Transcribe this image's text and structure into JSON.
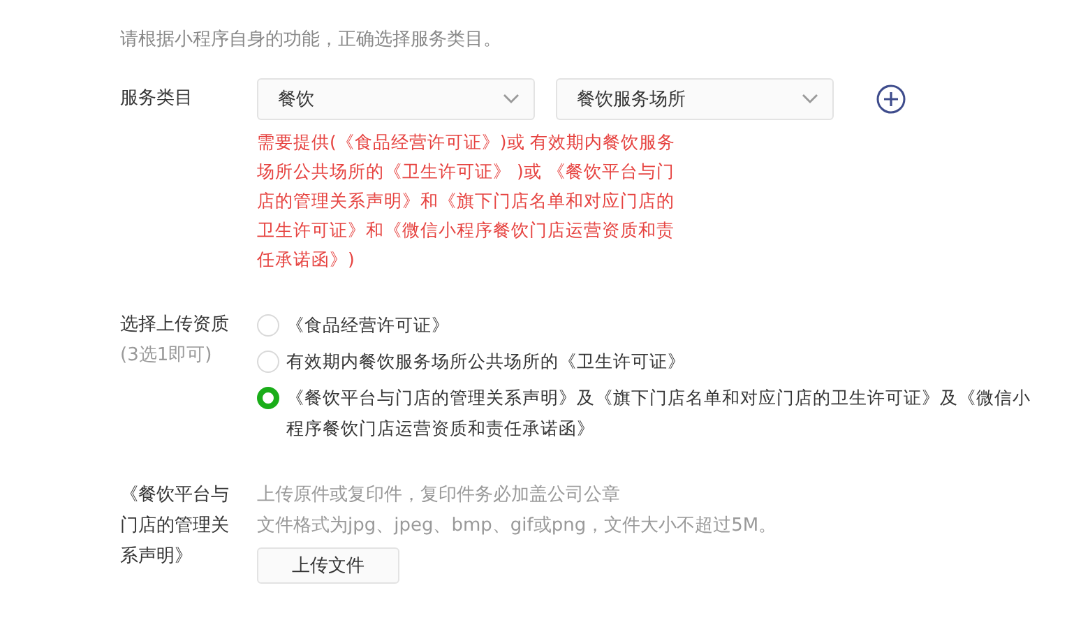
{
  "intro": "请根据小程序自身的功能，正确选择服务类目。",
  "category": {
    "label": "服务类目",
    "selects": [
      {
        "value": "餐饮"
      },
      {
        "value": "餐饮服务场所"
      }
    ],
    "requirement": "需要提供(《食品经营许可证》)或 有效期内餐饮服务场所公共场所的《卫生许可证》 )或 《餐饮平台与门店的管理关系声明》和《旗下门店名单和对应门店的卫生许可证》和《微信小程序餐饮门店运营资质和责任承诺函》)"
  },
  "qualification": {
    "label": "选择上传资质",
    "hint": "(3选1即可)",
    "options": [
      {
        "label": "《食品经营许可证》",
        "selected": false
      },
      {
        "label": "有效期内餐饮服务场所公共场所的《卫生许可证》",
        "selected": false
      },
      {
        "label": "《餐饮平台与门店的管理关系声明》及《旗下门店名单和对应门店的卫生许可证》及《微信小程序餐饮门店运营资质和责任承诺函》",
        "selected": true
      }
    ]
  },
  "upload": {
    "label": "《餐饮平台与门店的管理关系声明》",
    "notes": [
      "上传原件或复印件，复印件务必加盖公司公章",
      "文件格式为jpg、jpeg、bmp、gif或png，文件大小不超过5M。"
    ],
    "button": "上传文件"
  }
}
